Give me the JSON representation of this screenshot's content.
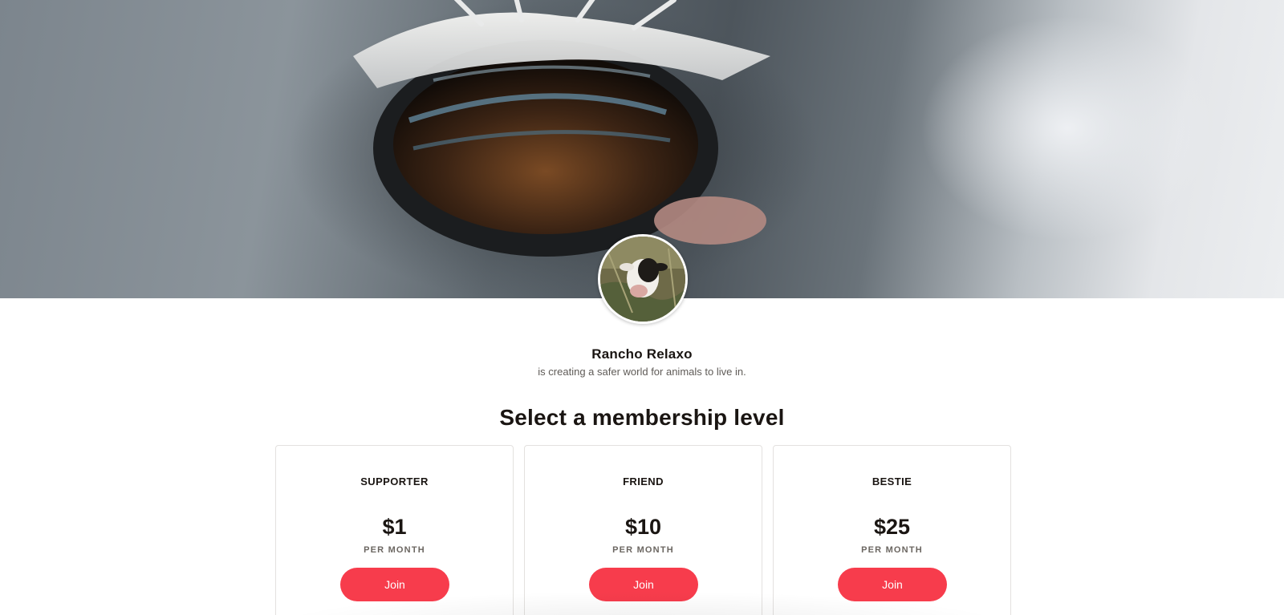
{
  "cover": {
    "image": "horse-eye-closeup"
  },
  "avatar": {
    "image": "cow-in-grass"
  },
  "creator": {
    "name": "Rancho Relaxo",
    "tagline": "is creating a safer world for animals to live in."
  },
  "section": {
    "title": "Select a membership level"
  },
  "tiers": [
    {
      "name": "SUPPORTER",
      "price": "$1",
      "period": "PER MONTH",
      "button": "Join"
    },
    {
      "name": "FRIEND",
      "price": "$10",
      "period": "PER MONTH",
      "button": "Join"
    },
    {
      "name": "BESTIE",
      "price": "$25",
      "period": "PER MONTH",
      "button": "Join"
    }
  ],
  "colors": {
    "accent": "#f73c4c",
    "text": "#1a1512",
    "muted": "#5f5b57"
  }
}
